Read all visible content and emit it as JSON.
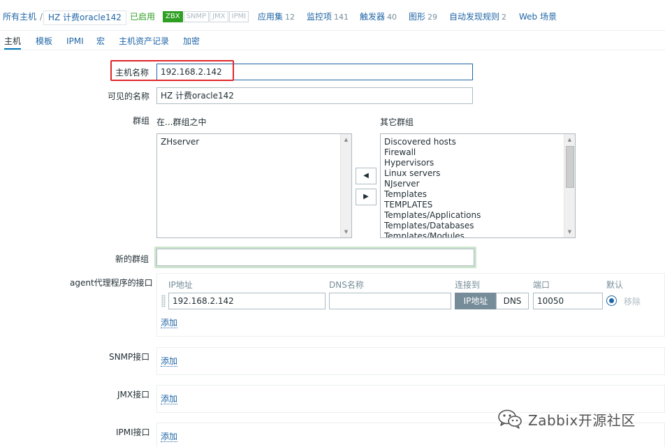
{
  "breadcrumb": {
    "all_hosts": "所有主机",
    "separator": "/",
    "current_host": "HZ 计费oracle142"
  },
  "status": {
    "enabled": "已启用",
    "availability": [
      {
        "label": "ZBX",
        "active": true
      },
      {
        "label": "SNMP",
        "active": false
      },
      {
        "label": "JMX",
        "active": false
      },
      {
        "label": "IPMI",
        "active": false
      }
    ]
  },
  "nav_links": [
    {
      "label": "应用集",
      "count": "12"
    },
    {
      "label": "监控项",
      "count": "141"
    },
    {
      "label": "触发器",
      "count": "40"
    },
    {
      "label": "图形",
      "count": "29"
    },
    {
      "label": "自动发现规则",
      "count": "2"
    },
    {
      "label": "Web 场景",
      "count": ""
    }
  ],
  "tabs": [
    "主机",
    "模板",
    "IPMI",
    "宏",
    "主机资产记录",
    "加密"
  ],
  "form": {
    "hostname_label": "主机名称",
    "hostname_value": "192.168.2.142",
    "visible_name_label": "可见的名称",
    "visible_name_value": "HZ  计费oracle142",
    "groups_label": "群组",
    "in_groups_label": "在...群组之中",
    "other_groups_label": "其它群组",
    "in_groups": [
      "ZHserver"
    ],
    "other_groups": [
      "Discovered hosts",
      "Firewall",
      "Hypervisors",
      "Linux servers",
      "NJserver",
      "Templates",
      "TEMPLATES",
      "Templates/Applications",
      "Templates/Databases",
      "Templates/Modules"
    ],
    "move_left": "◀",
    "move_right": "▶",
    "new_group_label": "新的群组",
    "new_group_value": ""
  },
  "agent": {
    "label": "agent代理程序的接口",
    "col_ip": "IP地址",
    "col_dns": "DNS名称",
    "col_connect": "连接到",
    "col_port": "端口",
    "col_default": "默认",
    "ip_value": "192.168.2.142",
    "dns_value": "",
    "connect_ip": "IP地址",
    "connect_dns": "DNS",
    "port_value": "10050",
    "remove": "移除",
    "add": "添加"
  },
  "snmp": {
    "label": "SNMP接口",
    "add": "添加"
  },
  "jmx": {
    "label": "JMX接口",
    "add": "添加"
  },
  "ipmi": {
    "label": "IPMI接口",
    "add": "添加"
  },
  "watermark": {
    "text": "Zabbix开源社区"
  }
}
